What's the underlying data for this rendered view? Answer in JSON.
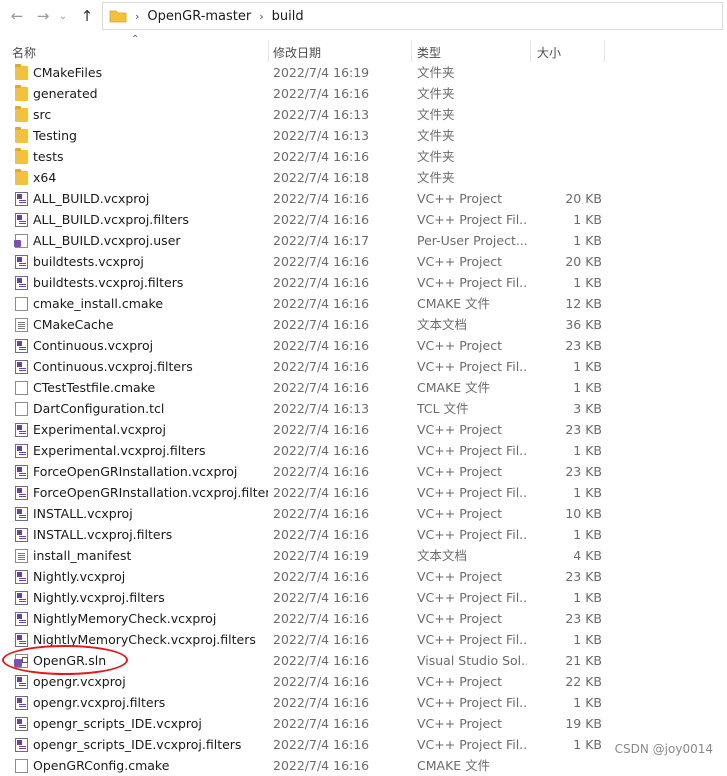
{
  "address": {
    "crumbs": [
      "OpenGR-master",
      "build"
    ]
  },
  "columns": {
    "name": "名称",
    "date": "修改日期",
    "type": "类型",
    "size": "大小"
  },
  "files": [
    {
      "name": "CMakeFiles",
      "date": "2022/7/4 16:19",
      "type": "文件夹",
      "size": "",
      "icon": "folder-icon"
    },
    {
      "name": "generated",
      "date": "2022/7/4 16:16",
      "type": "文件夹",
      "size": "",
      "icon": "folder-icon"
    },
    {
      "name": "src",
      "date": "2022/7/4 16:13",
      "type": "文件夹",
      "size": "",
      "icon": "folder-icon"
    },
    {
      "name": "Testing",
      "date": "2022/7/4 16:13",
      "type": "文件夹",
      "size": "",
      "icon": "folder-icon"
    },
    {
      "name": "tests",
      "date": "2022/7/4 16:16",
      "type": "文件夹",
      "size": "",
      "icon": "folder-icon"
    },
    {
      "name": "x64",
      "date": "2022/7/4 16:18",
      "type": "文件夹",
      "size": "",
      "icon": "folder-icon"
    },
    {
      "name": "ALL_BUILD.vcxproj",
      "date": "2022/7/4 16:16",
      "type": "VC++ Project",
      "size": "20 KB",
      "icon": "vcxproj-icon"
    },
    {
      "name": "ALL_BUILD.vcxproj.filters",
      "date": "2022/7/4 16:16",
      "type": "VC++ Project Fil...",
      "size": "1 KB",
      "icon": "vcxproj-icon"
    },
    {
      "name": "ALL_BUILD.vcxproj.user",
      "date": "2022/7/4 16:17",
      "type": "Per-User Project...",
      "size": "1 KB",
      "icon": "user-project-icon"
    },
    {
      "name": "buildtests.vcxproj",
      "date": "2022/7/4 16:16",
      "type": "VC++ Project",
      "size": "20 KB",
      "icon": "vcxproj-icon"
    },
    {
      "name": "buildtests.vcxproj.filters",
      "date": "2022/7/4 16:16",
      "type": "VC++ Project Fil...",
      "size": "1 KB",
      "icon": "vcxproj-icon"
    },
    {
      "name": "cmake_install.cmake",
      "date": "2022/7/4 16:16",
      "type": "CMAKE 文件",
      "size": "12 KB",
      "icon": "file-icon"
    },
    {
      "name": "CMakeCache",
      "date": "2022/7/4 16:16",
      "type": "文本文档",
      "size": "36 KB",
      "icon": "text-document-icon"
    },
    {
      "name": "Continuous.vcxproj",
      "date": "2022/7/4 16:16",
      "type": "VC++ Project",
      "size": "23 KB",
      "icon": "vcxproj-icon"
    },
    {
      "name": "Continuous.vcxproj.filters",
      "date": "2022/7/4 16:16",
      "type": "VC++ Project Fil...",
      "size": "1 KB",
      "icon": "vcxproj-icon"
    },
    {
      "name": "CTestTestfile.cmake",
      "date": "2022/7/4 16:16",
      "type": "CMAKE 文件",
      "size": "1 KB",
      "icon": "file-icon"
    },
    {
      "name": "DartConfiguration.tcl",
      "date": "2022/7/4 16:13",
      "type": "TCL 文件",
      "size": "3 KB",
      "icon": "file-icon"
    },
    {
      "name": "Experimental.vcxproj",
      "date": "2022/7/4 16:16",
      "type": "VC++ Project",
      "size": "23 KB",
      "icon": "vcxproj-icon"
    },
    {
      "name": "Experimental.vcxproj.filters",
      "date": "2022/7/4 16:16",
      "type": "VC++ Project Fil...",
      "size": "1 KB",
      "icon": "vcxproj-icon"
    },
    {
      "name": "ForceOpenGRInstallation.vcxproj",
      "date": "2022/7/4 16:16",
      "type": "VC++ Project",
      "size": "23 KB",
      "icon": "vcxproj-icon"
    },
    {
      "name": "ForceOpenGRInstallation.vcxproj.filters",
      "date": "2022/7/4 16:16",
      "type": "VC++ Project Fil...",
      "size": "1 KB",
      "icon": "vcxproj-icon"
    },
    {
      "name": "INSTALL.vcxproj",
      "date": "2022/7/4 16:16",
      "type": "VC++ Project",
      "size": "10 KB",
      "icon": "vcxproj-icon"
    },
    {
      "name": "INSTALL.vcxproj.filters",
      "date": "2022/7/4 16:16",
      "type": "VC++ Project Fil...",
      "size": "1 KB",
      "icon": "vcxproj-icon"
    },
    {
      "name": "install_manifest",
      "date": "2022/7/4 16:19",
      "type": "文本文档",
      "size": "4 KB",
      "icon": "text-document-icon"
    },
    {
      "name": "Nightly.vcxproj",
      "date": "2022/7/4 16:16",
      "type": "VC++ Project",
      "size": "23 KB",
      "icon": "vcxproj-icon"
    },
    {
      "name": "Nightly.vcxproj.filters",
      "date": "2022/7/4 16:16",
      "type": "VC++ Project Fil...",
      "size": "1 KB",
      "icon": "vcxproj-icon"
    },
    {
      "name": "NightlyMemoryCheck.vcxproj",
      "date": "2022/7/4 16:16",
      "type": "VC++ Project",
      "size": "23 KB",
      "icon": "vcxproj-icon"
    },
    {
      "name": "NightlyMemoryCheck.vcxproj.filters",
      "date": "2022/7/4 16:16",
      "type": "VC++ Project Fil...",
      "size": "1 KB",
      "icon": "vcxproj-icon"
    },
    {
      "name": "OpenGR.sln",
      "date": "2022/7/4 16:16",
      "type": "Visual Studio Sol...",
      "size": "21 KB",
      "icon": "solution-icon"
    },
    {
      "name": "opengr.vcxproj",
      "date": "2022/7/4 16:16",
      "type": "VC++ Project",
      "size": "22 KB",
      "icon": "vcxproj-icon"
    },
    {
      "name": "opengr.vcxproj.filters",
      "date": "2022/7/4 16:16",
      "type": "VC++ Project Fil...",
      "size": "1 KB",
      "icon": "vcxproj-icon"
    },
    {
      "name": "opengr_scripts_IDE.vcxproj",
      "date": "2022/7/4 16:16",
      "type": "VC++ Project",
      "size": "19 KB",
      "icon": "vcxproj-icon"
    },
    {
      "name": "opengr_scripts_IDE.vcxproj.filters",
      "date": "2022/7/4 16:16",
      "type": "VC++ Project Fil...",
      "size": "1 KB",
      "icon": "vcxproj-icon"
    },
    {
      "name": "OpenGRConfig.cmake",
      "date": "2022/7/4 16:16",
      "type": "CMAKE 文件",
      "size": "",
      "icon": "file-icon"
    }
  ],
  "watermark": "CSDN @joy0014",
  "colors": {
    "folder": "#f3c13a",
    "project_accent": "#6c3fa0",
    "annotation_circle": "#e0191c"
  }
}
